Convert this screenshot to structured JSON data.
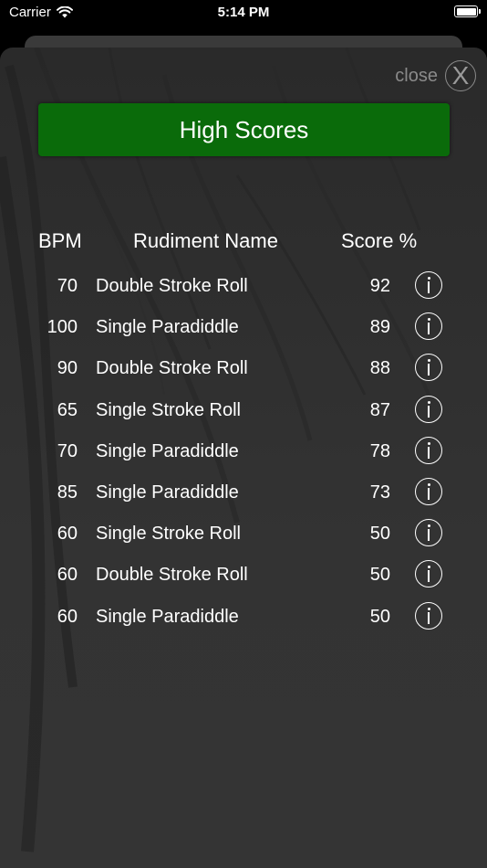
{
  "status_bar": {
    "carrier": "Carrier",
    "time": "5:14 PM",
    "wifi_icon": "wifi-icon",
    "battery_icon": "battery-icon"
  },
  "close": {
    "label": "close",
    "icon_glyph": "X",
    "icon": "close-icon"
  },
  "title": "High Scores",
  "colors": {
    "title_bar": "#0a6b0a",
    "sheet_background": "#2f2f2f",
    "text": "#ffffff",
    "close_text": "#8a8a8a"
  },
  "table": {
    "headers": {
      "bpm": "BPM",
      "name": "Rudiment Name",
      "score": "Score %"
    },
    "info_icon": "info-icon",
    "rows": [
      {
        "bpm": "70",
        "name": "Double Stroke Roll",
        "score": "92"
      },
      {
        "bpm": "100",
        "name": "Single Paradiddle",
        "score": "89"
      },
      {
        "bpm": "90",
        "name": "Double Stroke Roll",
        "score": "88"
      },
      {
        "bpm": "65",
        "name": "Single Stroke Roll",
        "score": "87"
      },
      {
        "bpm": "70",
        "name": "Single Paradiddle",
        "score": "78"
      },
      {
        "bpm": "85",
        "name": "Single Paradiddle",
        "score": "73"
      },
      {
        "bpm": "60",
        "name": "Single Stroke Roll",
        "score": "50"
      },
      {
        "bpm": "60",
        "name": "Double Stroke Roll",
        "score": "50"
      },
      {
        "bpm": "60",
        "name": "Single Paradiddle",
        "score": "50"
      }
    ]
  }
}
